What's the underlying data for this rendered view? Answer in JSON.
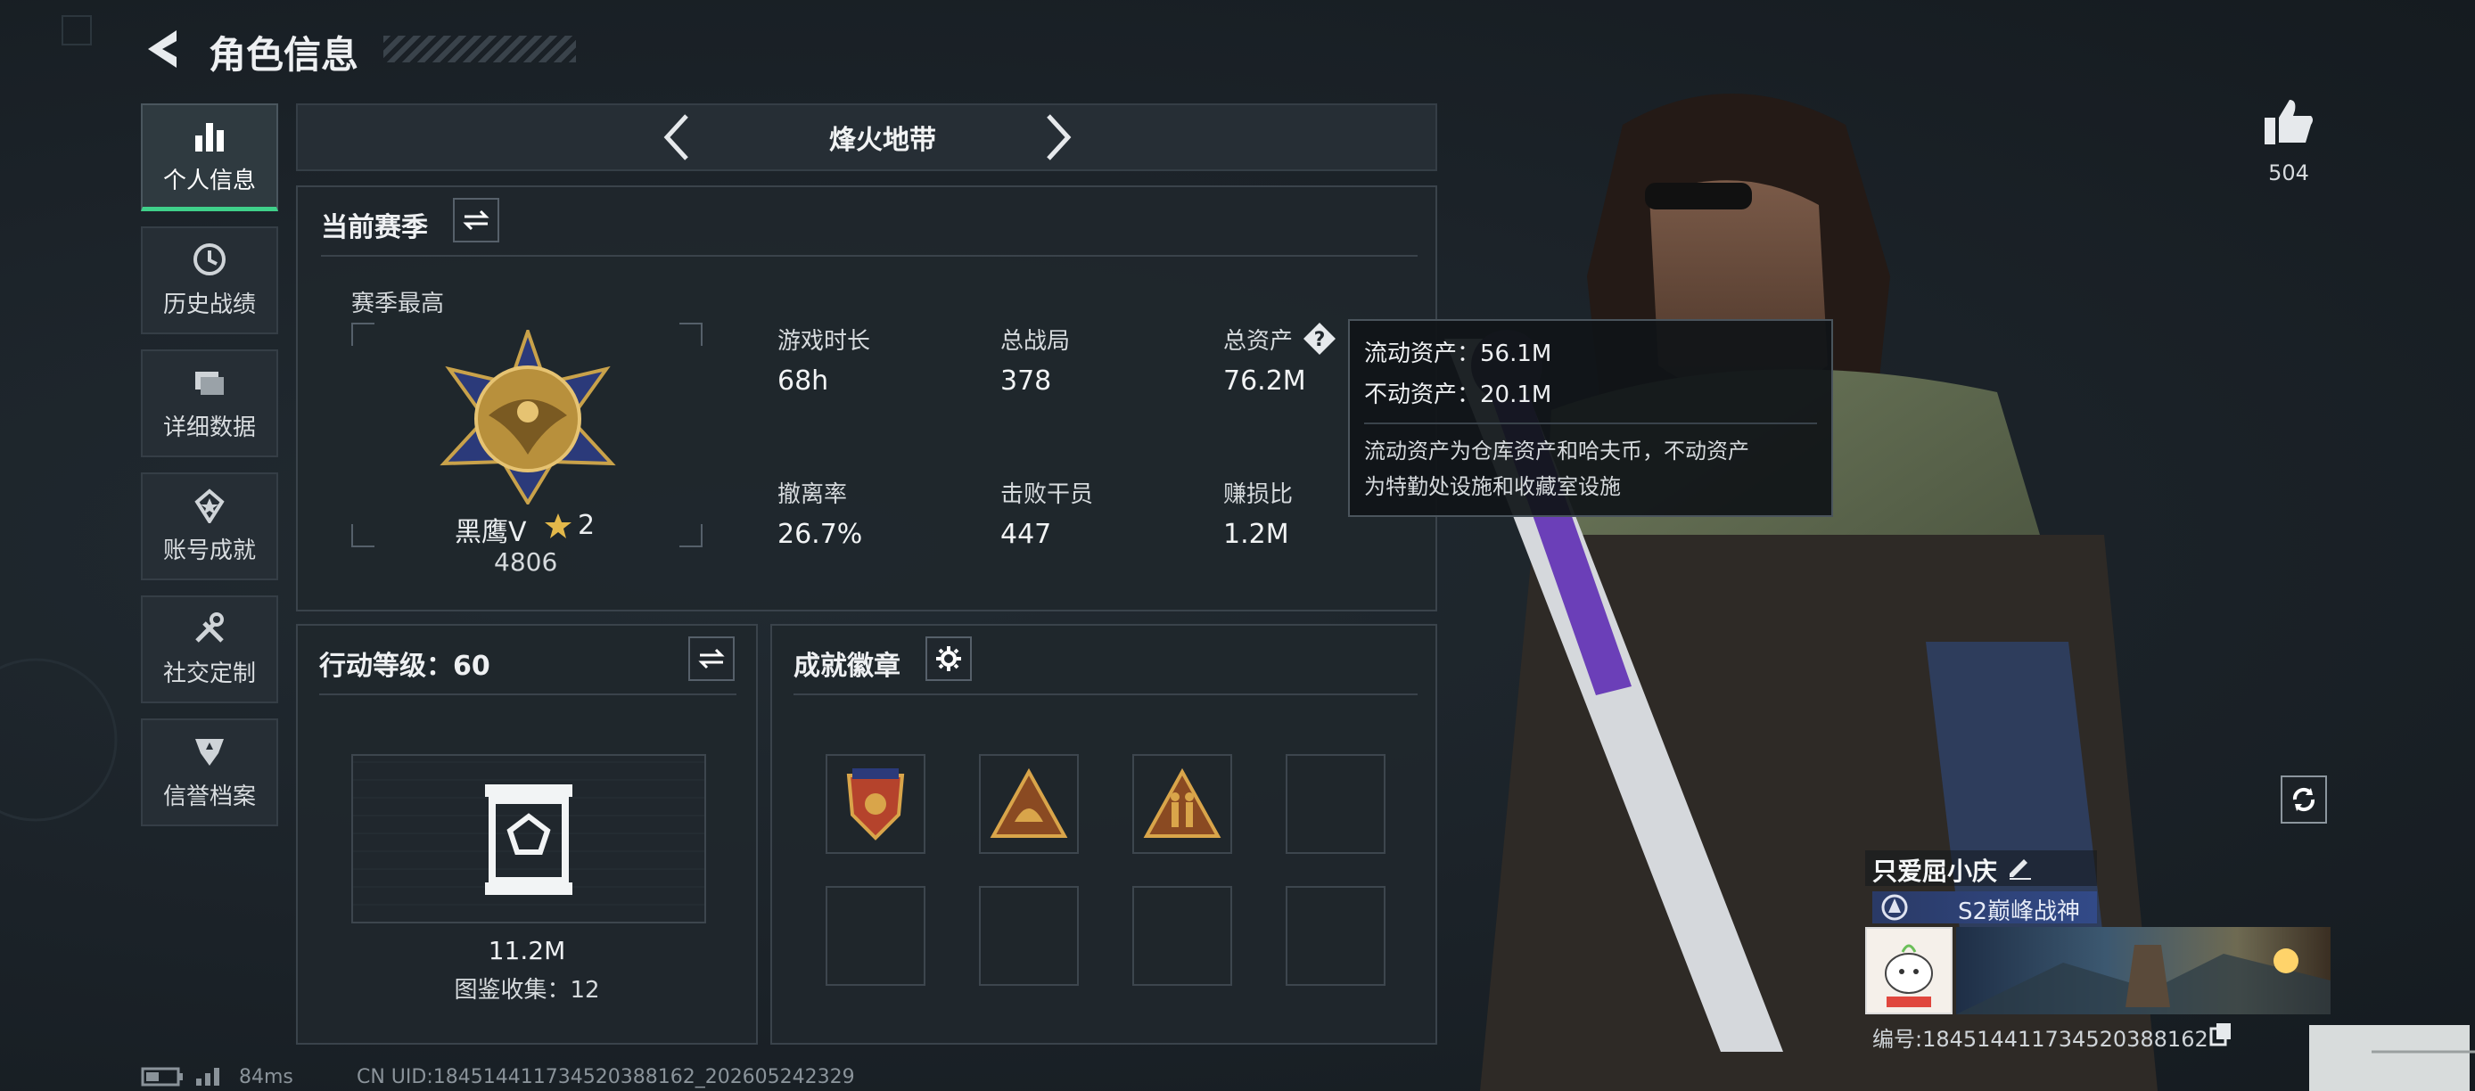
{
  "header": {
    "title": "角色信息"
  },
  "sidebar": {
    "items": [
      {
        "label": "个人信息",
        "icon": "bar-chart-icon",
        "active": true
      },
      {
        "label": "历史战绩",
        "icon": "clock-history-icon"
      },
      {
        "label": "详细数据",
        "icon": "folder-icon"
      },
      {
        "label": "账号成就",
        "icon": "medal-star-icon"
      },
      {
        "label": "社交定制",
        "icon": "tools-icon"
      },
      {
        "label": "信誉档案",
        "icon": "shield-badge-icon"
      }
    ]
  },
  "mode": {
    "label": "烽火地带"
  },
  "season": {
    "title": "当前赛季",
    "best_label": "赛季最高",
    "rank_name": "黑鹰V",
    "rank_stars": "2",
    "rank_score": "4806",
    "stats": [
      {
        "label": "游戏时长",
        "value": "68h"
      },
      {
        "label": "总战局",
        "value": "378"
      },
      {
        "label": "总资产",
        "value": "76.2M"
      },
      {
        "label": "撤离率",
        "value": "26.7%"
      },
      {
        "label": "击败干员",
        "value": "447"
      },
      {
        "label": "赚损比",
        "value": "1.2M"
      }
    ]
  },
  "tooltip": {
    "liquid": "流动资产：56.1M",
    "fixed": "不动资产：20.1M",
    "desc_line1": "流动资产为仓库资产和哈夫币，不动资产",
    "desc_line2": "为特勤处设施和收藏室设施"
  },
  "action_level": {
    "title": "行动等级：60",
    "value": "11.2M",
    "collection": "图鉴收集：12"
  },
  "achievements": {
    "title": "成就徽章"
  },
  "likes": {
    "count": "504"
  },
  "player": {
    "name": "只爱屈小庆",
    "title": "S2巅峰战神",
    "id_text": "编号:1845144117345203881​62"
  },
  "footer": {
    "ping": "84ms",
    "uid": "CN UID:1845144117345203881​62_202605242329"
  },
  "colors": {
    "accent_green": "#3fd08a",
    "gold": "#c9a24a",
    "panel": "#20272d"
  }
}
